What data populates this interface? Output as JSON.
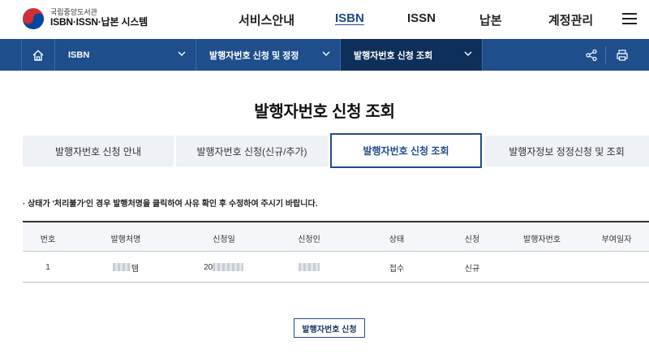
{
  "header": {
    "logo_sub": "국립중앙도서관",
    "logo_main": "ISBN·ISSN·납본 시스템",
    "nav": [
      "서비스안내",
      "ISBN",
      "ISSN",
      "납본",
      "계정관리"
    ]
  },
  "breadcrumb": {
    "level1": "ISBN",
    "level2": "발행자번호 신청 및 정정",
    "level3": "발행자번호 신청 조회"
  },
  "page_title": "발행자번호 신청 조회",
  "tabs": [
    {
      "label": "발행자번호 신청 안내",
      "active": false
    },
    {
      "label": "발행자번호 신청(신규/추가)",
      "active": false
    },
    {
      "label": "발행자번호 신청 조회",
      "active": true
    },
    {
      "label": "발행자정보 정정신청 및 조회",
      "active": false
    }
  ],
  "notice": "· 상태가 '처리불가'인 경우 발행처명을 클릭하여 사유 확인 후 수정하여 주시기 바랍니다.",
  "table": {
    "headers": [
      "번호",
      "발행처명",
      "신청일",
      "신청인",
      "상태",
      "신청",
      "발행자번호",
      "부여일자"
    ],
    "rows": [
      {
        "no": "1",
        "publisher_suffix": "템",
        "date_prefix": "20",
        "applicant_suffix": "",
        "status": "접수",
        "type": "신규",
        "publisher_no": "",
        "assigned_date": ""
      }
    ]
  },
  "apply_button": "발행자번호 신청",
  "colors": {
    "primary": "#1e4e8c",
    "active_crumb": "#0f2f5b",
    "tab_bg": "#eef1f6"
  }
}
